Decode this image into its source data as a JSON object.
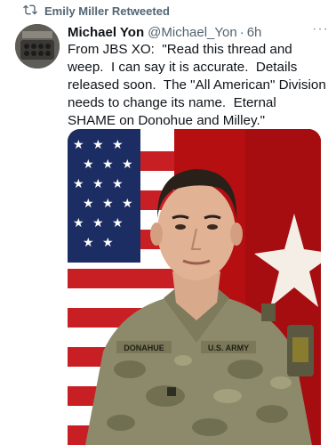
{
  "retweet": {
    "text": "Emily Miller Retweeted",
    "icon": "retweet-icon"
  },
  "tweet": {
    "author_name": "Michael Yon",
    "handle": "@Michael_Yon",
    "separator": "·",
    "time": "6h",
    "more_label": "···",
    "text": "From JBS XO:  \"Read this thread and weep.  I can say it is accurate.  Details released soon.  The \"All American\" Division needs to change its name.  Eternal SHAME on Donohue and Milley.\""
  },
  "media": {
    "name_tape": "DONAHUE",
    "branch_tape": "U.S. ARMY"
  },
  "colors": {
    "text": "#0f1419",
    "muted": "#536471",
    "flag_red": "#b50f12",
    "flag_blue": "#1c2d63"
  }
}
